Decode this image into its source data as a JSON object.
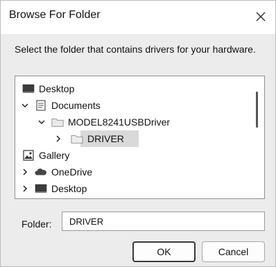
{
  "dialog": {
    "title": "Browse For Folder",
    "instruction": "Select the folder that contains drivers for your hardware."
  },
  "tree": {
    "items": [
      {
        "label": "Desktop",
        "icon": "desktop-icon",
        "chevron": "none"
      },
      {
        "label": "Documents",
        "icon": "documents-icon",
        "chevron": "expanded"
      },
      {
        "label": "MODEL8241USBDriver",
        "icon": "folder-icon",
        "chevron": "expanded"
      },
      {
        "label": "DRIVER",
        "icon": "folder-icon",
        "chevron": "collapsed",
        "selected": true
      },
      {
        "label": "Gallery",
        "icon": "gallery-icon",
        "chevron": "none"
      },
      {
        "label": "OneDrive",
        "icon": "cloud-icon",
        "chevron": "collapsed"
      },
      {
        "label": "Desktop",
        "icon": "desktop-icon",
        "chevron": "collapsed"
      }
    ]
  },
  "folder": {
    "label": "Folder:",
    "value": "DRIVER"
  },
  "buttons": {
    "ok": "OK",
    "cancel": "Cancel"
  }
}
